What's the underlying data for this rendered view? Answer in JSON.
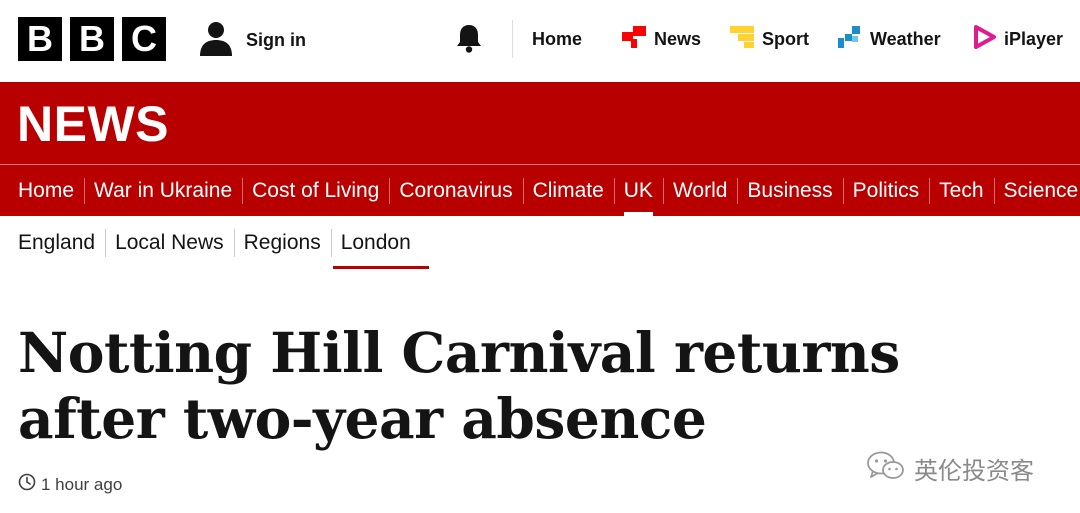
{
  "masthead": {
    "logo_letters": [
      "B",
      "B",
      "C"
    ],
    "sign_in": "Sign in",
    "nav": [
      {
        "label": "Home",
        "icon": "none"
      },
      {
        "label": "News",
        "icon": "news-icon",
        "color": "#ff0000"
      },
      {
        "label": "Sport",
        "icon": "sport-icon",
        "color": "#ffd230"
      },
      {
        "label": "Weather",
        "icon": "weather-icon",
        "color": "#1b8dcb"
      },
      {
        "label": "iPlayer",
        "icon": "iplayer-icon",
        "color": "#e01a8f"
      }
    ]
  },
  "banner": {
    "title": "NEWS",
    "color": "#b80000"
  },
  "primary_nav": {
    "items": [
      "Home",
      "War in Ukraine",
      "Cost of Living",
      "Coronavirus",
      "Climate",
      "UK",
      "World",
      "Business",
      "Politics",
      "Tech",
      "Science"
    ],
    "active": "UK"
  },
  "secondary_nav": {
    "items": [
      "England",
      "Local News",
      "Regions",
      "London"
    ],
    "active": "London"
  },
  "article": {
    "headline": "Notting Hill Carnival returns after two-year absence",
    "timestamp": "1 hour ago"
  },
  "watermark": {
    "text": "英伦投资客",
    "icon": "wechat-icon"
  }
}
